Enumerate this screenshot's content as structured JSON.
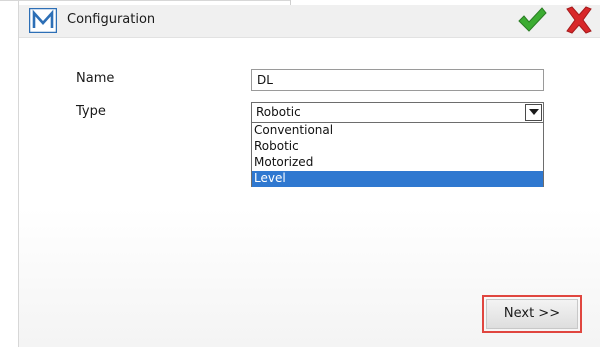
{
  "window": {
    "title": "Configuration",
    "logo_icon": "m-logo-icon",
    "ok_icon": "checkmark-icon",
    "cancel_icon": "close-icon",
    "accent": "#2f78d0",
    "ok_color": "#3cac32",
    "cancel_color": "#d8282a"
  },
  "form": {
    "name_label": "Name",
    "name_value": "DL",
    "type_label": "Type",
    "type_selected": "Robotic",
    "type_options": [
      "Conventional",
      "Robotic",
      "Motorized",
      "Level"
    ],
    "type_highlighted": "Level"
  },
  "footer": {
    "next_label": "Next >>",
    "highlight_color": "#e0463f"
  }
}
